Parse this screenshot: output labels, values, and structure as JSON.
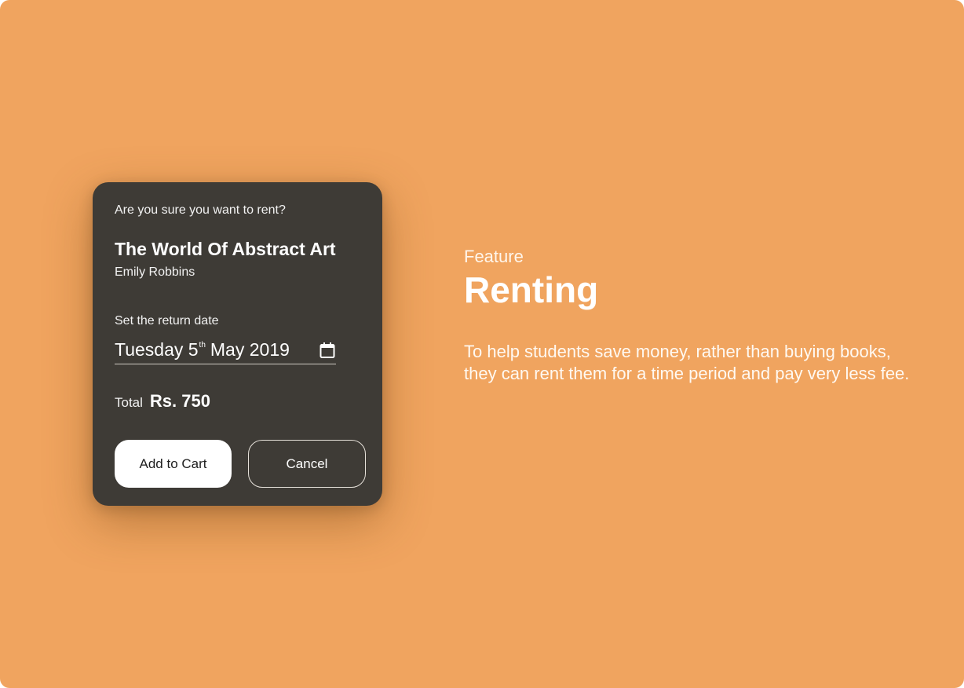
{
  "colors": {
    "background": "#f0a45f",
    "dialog": "#3e3b36",
    "primary_button": "#ffffff",
    "text_light": "#ffffff"
  },
  "dialog": {
    "question": "Are you sure you want to rent?",
    "book_title": "The World Of Abstract Art",
    "book_author": "Emily Robbins",
    "return_date_label": "Set the return date",
    "return_date": {
      "weekday": "Tuesday 5",
      "ordinal_suffix": "th",
      "month_year": "May 2019"
    },
    "calendar_icon": "calendar-icon",
    "total_label": "Total",
    "total_amount": "Rs. 750",
    "add_to_cart_label": "Add to Cart",
    "cancel_label": "Cancel"
  },
  "feature": {
    "label": "Feature",
    "title": "Renting",
    "description": "To help students save money, rather than buying books, they can rent them for a time period and pay very less fee."
  }
}
